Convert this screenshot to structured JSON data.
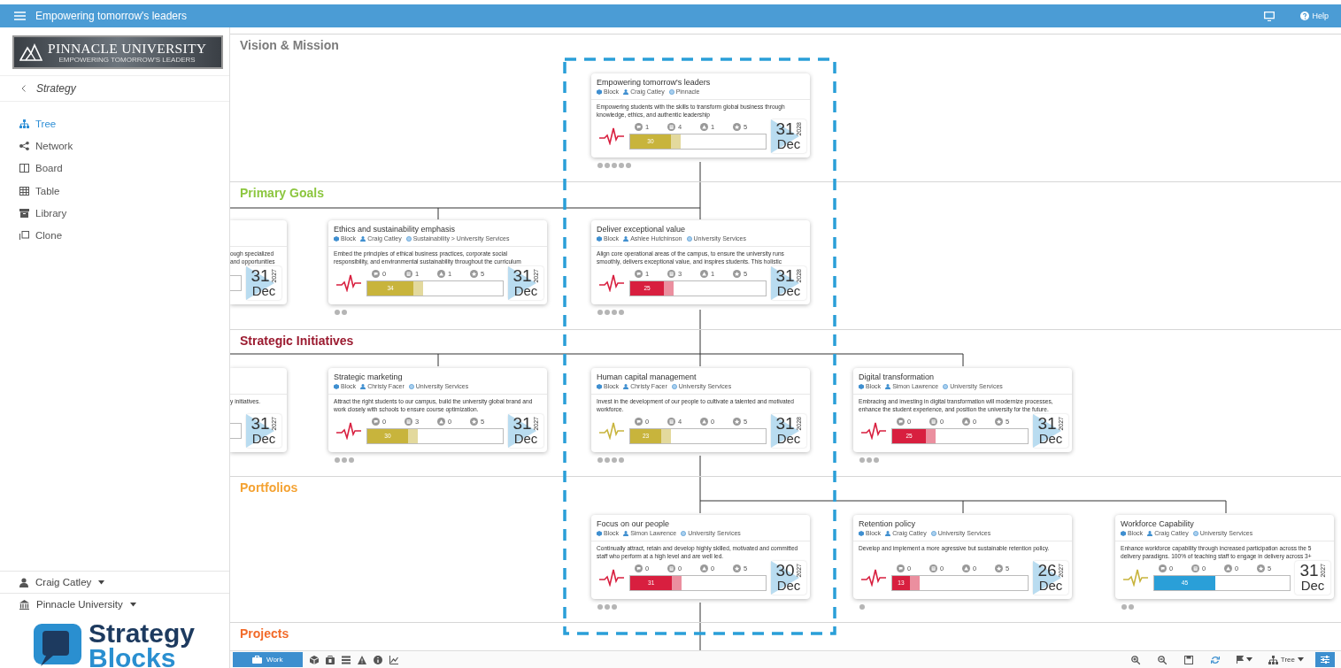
{
  "topbar": {
    "title": "Empowering tomorrow's leaders",
    "help": "Help"
  },
  "sidebar": {
    "org_logo": {
      "name": "PINNACLE UNIVERSITY",
      "tagline": "EMPOWERING TOMORROW'S LEADERS"
    },
    "back": "Strategy",
    "nav": [
      {
        "label": "Tree",
        "selected": true
      },
      {
        "label": "Network",
        "selected": false
      },
      {
        "label": "Board",
        "selected": false
      },
      {
        "label": "Table",
        "selected": false
      },
      {
        "label": "Library",
        "selected": false
      },
      {
        "label": "Clone",
        "selected": false
      }
    ],
    "user": "Craig Catley",
    "workspace": "Pinnacle University",
    "brand": [
      "Strategy",
      "Blocks"
    ]
  },
  "selection_frame": true,
  "lanes": [
    {
      "title": "Vision & Mission",
      "color": "#7b7b7b",
      "cards": [
        {
          "kind": "full",
          "title": "Empowering tomorrow's leaders",
          "type": "Block",
          "owner": "Craig Catley",
          "unit": "Pinnacle",
          "description": "Empowering students with the skills to transform global business through knowledge, ethics, and authentic leadership",
          "pulse": {
            "color": "#d81f3f"
          },
          "stats": [
            "1",
            "4",
            "1",
            "5"
          ],
          "progress": {
            "level": 0.3,
            "value": "30",
            "color": "#c8b43c",
            "forecast": true
          },
          "date": {
            "day": "31",
            "year": "2028",
            "month": "Dec",
            "flagged": true
          },
          "dots": [
            {
              "kind": "dot"
            },
            {
              "kind": "dot"
            },
            {
              "kind": "dot"
            },
            {
              "kind": "dot"
            },
            {
              "kind": "dot"
            }
          ]
        }
      ]
    },
    {
      "title": "Primary Goals",
      "color": "#8cc63f",
      "cards": [
        {
          "kind": "clipped",
          "description": "ough specialized\nand opportunities",
          "date": {
            "day": "31",
            "year": "2027",
            "month": "Dec",
            "flagged": true
          }
        },
        {
          "kind": "full",
          "title": "Ethics and sustainability emphasis",
          "type": "Block",
          "owner": "Craig Catley",
          "unit": "Sustainability > University Services",
          "description": "Embed the principles of ethical business practices, corporate social responsibility, and environmental sustainability throughout the curriculum",
          "pulse": {
            "color": "#d81f3f"
          },
          "stats": [
            "0",
            "1",
            "1",
            "5"
          ],
          "progress": {
            "level": 0.34,
            "value": "34",
            "color": "#c8b43c",
            "forecast": true
          },
          "date": {
            "day": "31",
            "year": "2027",
            "month": "Dec",
            "flagged": true
          },
          "dots": [
            {
              "kind": "dot"
            },
            {
              "kind": "dot"
            }
          ]
        },
        {
          "kind": "full",
          "title": "Deliver exceptional value",
          "type": "Block",
          "owner": "Ashlee Hutchinson",
          "unit": "University Services",
          "description": "Align core operational areas of the campus, to ensure the university runs smoothly, delivers exceptional value, and inspires students. This holistic",
          "pulse": {
            "color": "#d81f3f"
          },
          "stats": [
            "1",
            "3",
            "1",
            "5"
          ],
          "progress": {
            "level": 0.25,
            "value": "25",
            "color": "#d81f3f",
            "forecast": true
          },
          "date": {
            "day": "31",
            "year": "2028",
            "month": "Dec",
            "flagged": true
          },
          "dots": [
            {
              "kind": "dot"
            },
            {
              "kind": "dot"
            },
            {
              "kind": "dot"
            },
            {
              "kind": "dot"
            }
          ]
        }
      ]
    },
    {
      "title": "Strategic Initiatives",
      "color": "#9b1b30",
      "cards": [
        {
          "kind": "clipped",
          "description": "y initiatives.",
          "date": {
            "day": "31",
            "year": "2027",
            "month": "Dec",
            "flagged": true
          }
        },
        {
          "kind": "full",
          "title": "Strategic marketing",
          "type": "Block",
          "owner": "Christy Facer",
          "unit": "University Services",
          "description": "Attract the right students to our campus, build the university global brand and work closely with schools to ensure course optimization.",
          "pulse": {
            "color": "#d81f3f"
          },
          "stats": [
            "0",
            "3",
            "0",
            "5"
          ],
          "progress": {
            "level": 0.3,
            "value": "30",
            "color": "#c8b43c",
            "forecast": true
          },
          "date": {
            "day": "31",
            "year": "2027",
            "month": "Dec",
            "flagged": true
          },
          "dots": [
            {
              "kind": "dot"
            },
            {
              "kind": "dot"
            },
            {
              "kind": "dot"
            }
          ]
        },
        {
          "kind": "full",
          "title": "Human capital management",
          "type": "Block",
          "owner": "Christy Facer",
          "unit": "University Services",
          "description": "Invest in the development of our people to cultivate a talented and motivated workforce.",
          "pulse": {
            "color": "#c8b43c"
          },
          "stats": [
            "0",
            "4",
            "0",
            "5"
          ],
          "progress": {
            "level": 0.23,
            "value": "23",
            "color": "#c8b43c",
            "forecast": true
          },
          "date": {
            "day": "31",
            "year": "2028",
            "month": "Dec",
            "flagged": true
          },
          "dots": [
            {
              "kind": "dot"
            },
            {
              "kind": "dot"
            },
            {
              "kind": "dot"
            },
            {
              "kind": "dot"
            }
          ]
        },
        {
          "kind": "full",
          "title": "Digital transformation",
          "type": "Block",
          "owner": "Simon Lawrence",
          "unit": "University Services",
          "description": "Embracing and investing in digital transformation will modernize processes, enhance the student experience, and position the university for the future.",
          "pulse": {
            "color": "#d81f3f"
          },
          "stats": [
            "0",
            "0",
            "0",
            "5"
          ],
          "progress": {
            "level": 0.25,
            "value": "25",
            "color": "#d81f3f",
            "forecast": true
          },
          "date": {
            "day": "31",
            "year": "2027",
            "month": "Dec",
            "flagged": true
          },
          "dots": [
            {
              "kind": "dot"
            },
            {
              "kind": "dot"
            },
            {
              "kind": "dot"
            }
          ]
        }
      ]
    },
    {
      "title": "Portfolios",
      "color": "#f4a232",
      "cards": [
        {
          "kind": "full",
          "title": "Focus on our people",
          "type": "Block",
          "owner": "Simon Lawrence",
          "unit": "University Services",
          "description": "Continually attract, retain and develop highly skilled, motivated and committed staff who perform at a high level and are well led.",
          "pulse": {
            "color": "#d81f3f"
          },
          "stats": [
            "0",
            "0",
            "0",
            "5"
          ],
          "progress": {
            "level": 0.31,
            "value": "31",
            "color": "#d81f3f",
            "forecast": true
          },
          "date": {
            "day": "30",
            "year": "2027",
            "month": "Dec",
            "flagged": true
          },
          "dots": [
            {
              "kind": "dot"
            },
            {
              "kind": "dot"
            },
            {
              "kind": "dot"
            }
          ]
        },
        {
          "kind": "full",
          "title": "Retention policy",
          "type": "Block",
          "owner": "Craig Catley",
          "unit": "University Services",
          "description": "Develop and implement a more agressive but sustainable retention policy.",
          "pulse": {
            "color": "#d81f3f"
          },
          "stats": [
            "0",
            "0",
            "0",
            "5"
          ],
          "progress": {
            "level": 0.13,
            "value": "13",
            "color": "#d81f3f",
            "forecast": true
          },
          "date": {
            "day": "26",
            "year": "2027",
            "month": "Dec",
            "flagged": true
          },
          "dots": [
            {
              "kind": "dot"
            }
          ]
        },
        {
          "kind": "full",
          "title": "Workforce Capability",
          "type": "Block",
          "owner": "Craig Catley",
          "unit": "University Services",
          "description": "Enhance workforce capability through increased participation across the 5 delivery paradigns. 100% of teaching staff to engage in delivery across 3+",
          "pulse": {
            "color": "#c8b43c"
          },
          "stats": [
            "0",
            "0",
            "0",
            "5"
          ],
          "progress": {
            "level": 0.45,
            "value": "45",
            "color": "#2a9fd8",
            "forecast": false
          },
          "date": {
            "day": "31",
            "year": "2027",
            "month": "Dec",
            "flagged": false
          },
          "dots": [
            {
              "kind": "dot"
            },
            {
              "kind": "dot"
            }
          ]
        }
      ]
    },
    {
      "title": "Projects",
      "color": "#f26b2a"
    }
  ],
  "toolbar": {
    "work": "Work",
    "view": "Tree"
  }
}
